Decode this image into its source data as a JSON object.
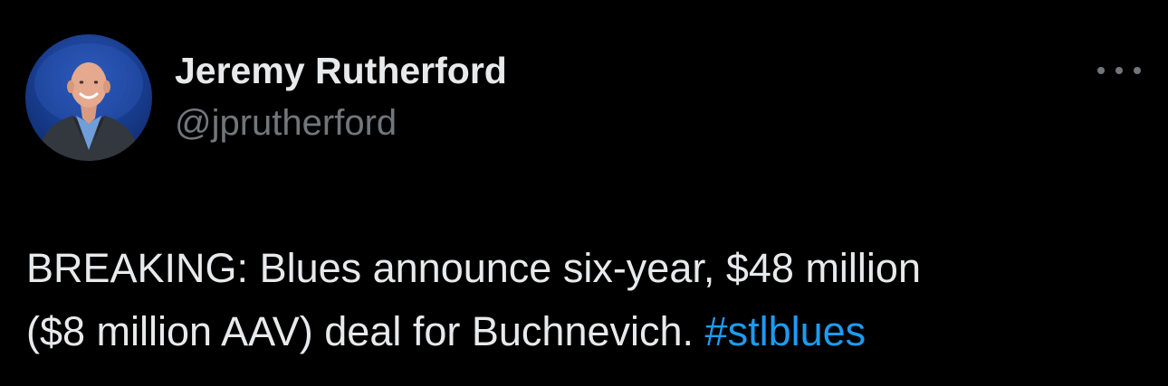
{
  "author": {
    "display_name": "Jeremy Rutherford",
    "handle": "@jprutherford"
  },
  "more_icon": "more-horizontal-icon",
  "tweet": {
    "line1": "BREAKING: Blues announce six-year, $48 million",
    "line2": "($8 million AAV) deal for Buchnevich.",
    "hashtag": "#stlblues"
  },
  "colors": {
    "background": "#000000",
    "primary_text": "#e7e9ea",
    "secondary_text": "#71767b",
    "link": "#1d9bf0"
  }
}
